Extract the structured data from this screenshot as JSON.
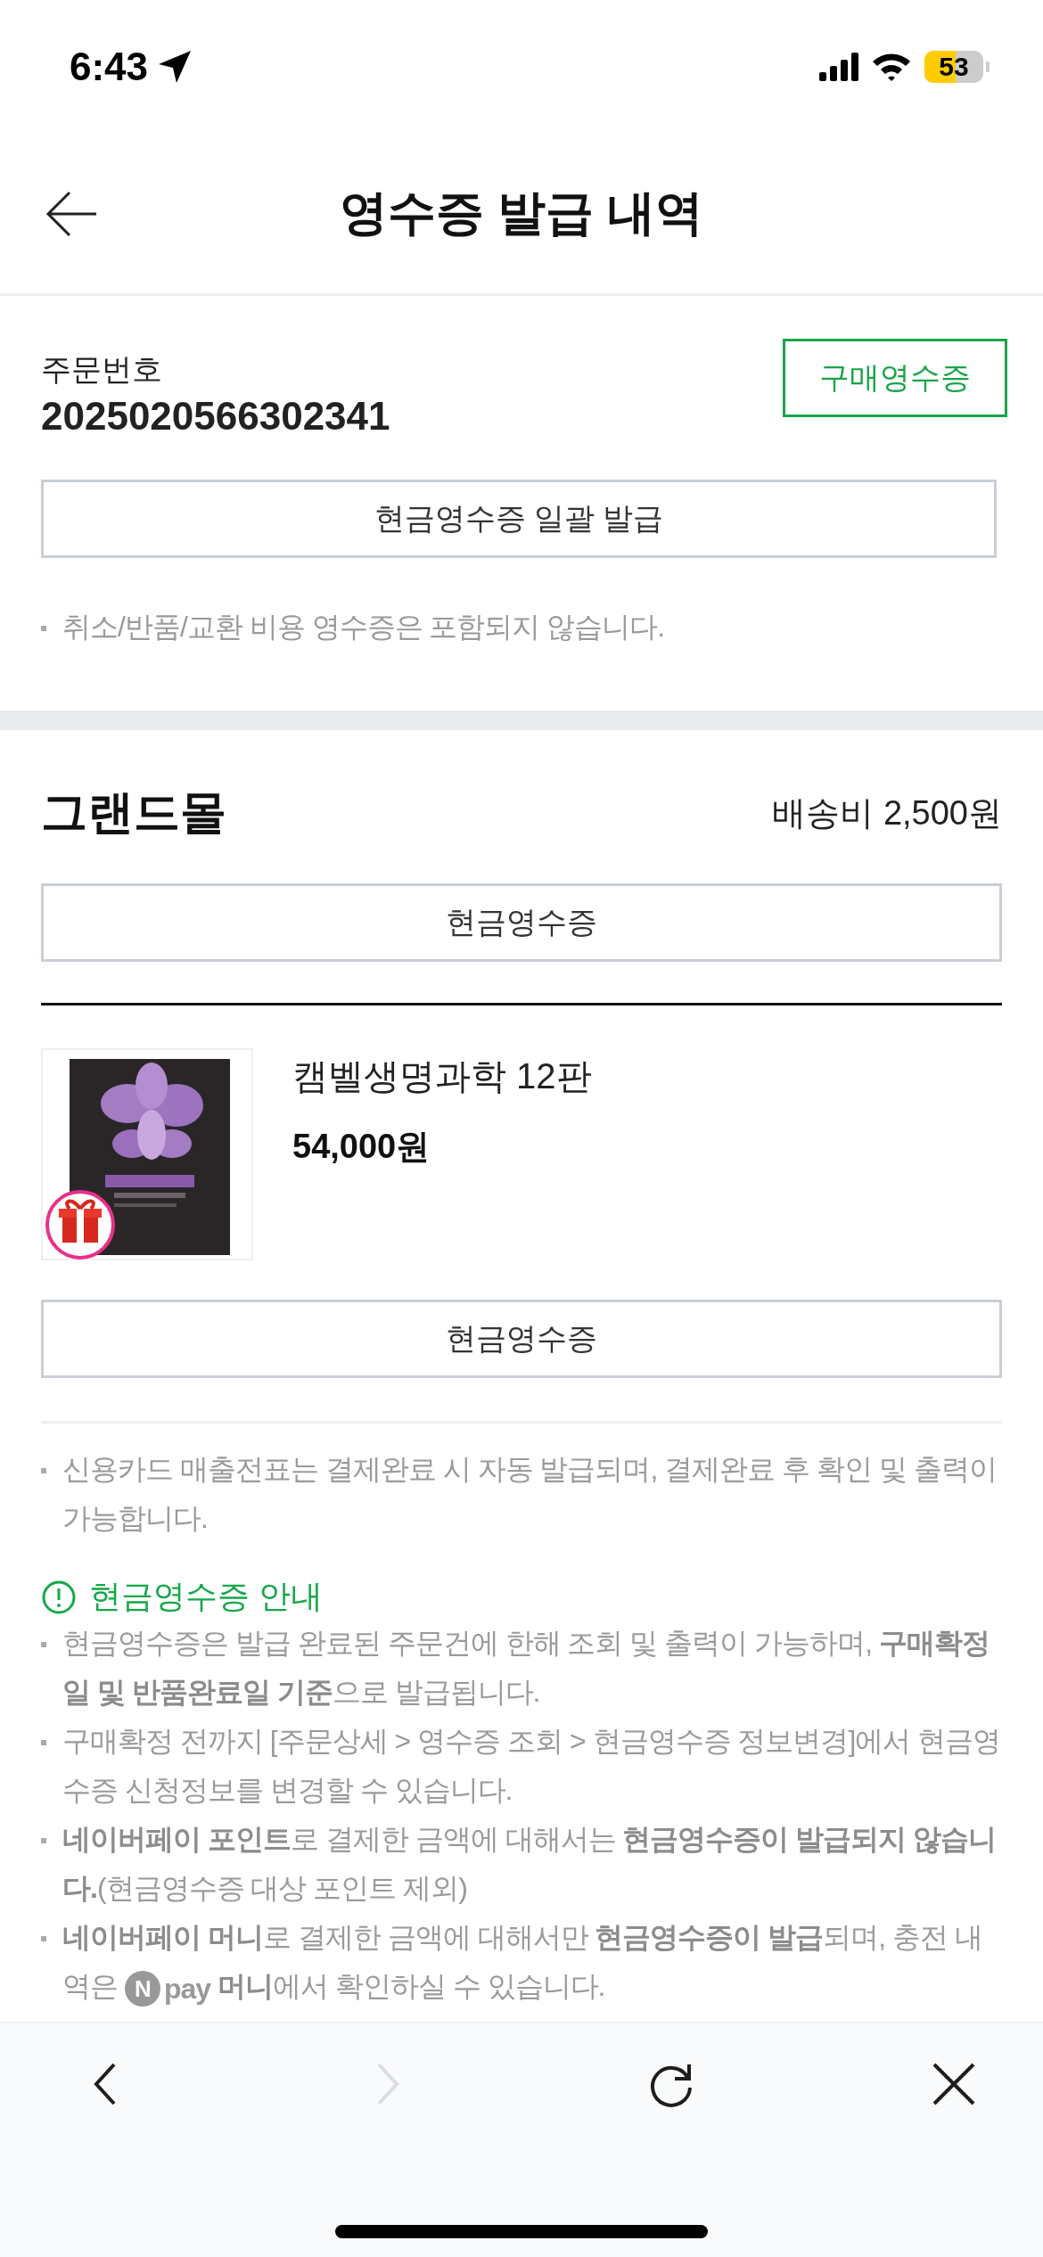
{
  "status_bar": {
    "time": "6:43",
    "battery": "53"
  },
  "header": {
    "title": "영수증 발급 내역"
  },
  "order": {
    "label": "주문번호",
    "number": "2025020566302341",
    "receipt_button": "구매영수증",
    "bulk_button": "현금영수증 일괄 발급",
    "note": "취소/반품/교환 비용 영수증은 포함되지 않습니다."
  },
  "seller": {
    "name": "그랜드몰",
    "shipping_fee": "배송비 2,500원",
    "cash_receipt_button": "현금영수증"
  },
  "items": [
    {
      "kind": "picture",
      "gift": true,
      "title": "캠벨생명과학 12판",
      "price": "54,000원",
      "cash_receipt_button": "현금영수증"
    }
  ],
  "notes": [
    {
      "parts": [
        {
          "kind": "text",
          "text": "신용카드 매출전표는 결제완료 시 자동 발급되며, 결제완료 후 확인 및 출력이 가능합니다."
        }
      ]
    }
  ],
  "guide": {
    "title": "현금영수증 안내",
    "notes": [
      {
        "parts": [
          {
            "kind": "text",
            "text": "현금영수증은 발급 완료된 주문건에 한해 조회 및 출력이 가능하며, **구매확정일 및 반품완료일 기준**으로 발급됩니다."
          }
        ]
      },
      {
        "parts": [
          {
            "kind": "text",
            "text": "구매확정 전까지 [주문상세 > 영수증 조회 > 현금영수증 정보변경]에서 현금영수증 신청정보를 변경할 수 있습니다."
          }
        ]
      },
      {
        "parts": [
          {
            "kind": "text",
            "text": "**네이버페이 포인트**로 결제한 금액에 대해서는 **현금영수증이 발급되지 않습니다.**(현금영수증 대상 포인트 제외)"
          }
        ]
      },
      {
        "parts": [
          {
            "kind": "text",
            "text": "**네이버페이 머니**로 결제한 금액에 대해서만 **현금영수증이 발급**되며, 충전 내역은 "
          },
          {
            "kind": "logo",
            "mark": "N",
            "text": "pay"
          },
          {
            "kind": "text",
            "text": " **머니**에서 확인하실 수 있습니다."
          }
        ]
      }
    ]
  },
  "nav": [
    {
      "kind": "back",
      "disabled": false
    },
    {
      "kind": "forward",
      "disabled": true
    },
    {
      "kind": "reload",
      "disabled": false
    },
    {
      "kind": "close",
      "disabled": false
    }
  ]
}
